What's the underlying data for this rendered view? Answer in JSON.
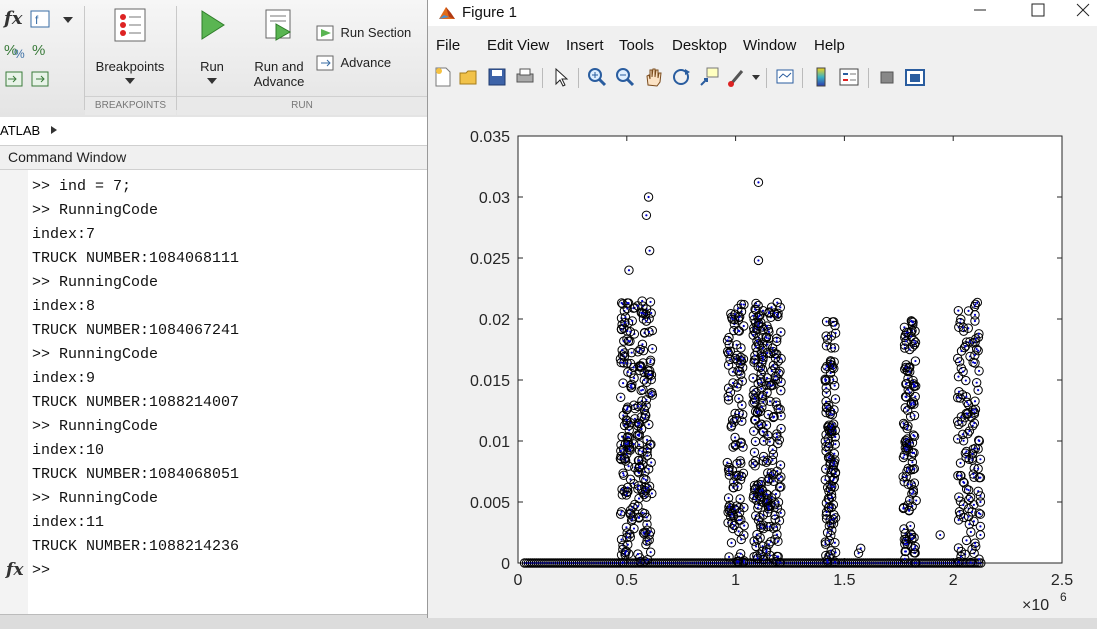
{
  "ribbon": {
    "breakpoints_label": "Breakpoints",
    "run_label": "Run",
    "run_and_advance_label": "Run and\nAdvance",
    "run_and_advance_line1": "Run and",
    "run_and_advance_line2": "Advance",
    "run_section_label": "Run Section",
    "advance_label": "Advance",
    "group_breakpoints": "BREAKPOINTS",
    "group_run": "RUN"
  },
  "address_bar": {
    "path": "ATLAB"
  },
  "command_window": {
    "title": "Command Window",
    "lines": [
      ">> ind = 7;",
      ">> RunningCode",
      "index:7",
      "TRUCK NUMBER:1084068111",
      ">> RunningCode",
      "index:8",
      "TRUCK NUMBER:1084067241",
      ">> RunningCode",
      "index:9",
      "TRUCK NUMBER:1088214007",
      ">> RunningCode",
      "index:10",
      "TRUCK NUMBER:1084068051",
      ">> RunningCode",
      "index:11",
      "TRUCK NUMBER:1088214236"
    ],
    "prompt": ">>",
    "prompt_icon": "fx"
  },
  "figure": {
    "title": "Figure 1",
    "menu": [
      "File",
      "Edit",
      "View",
      "Insert",
      "Tools",
      "Desktop",
      "Window",
      "Help"
    ],
    "toolbar_icons": [
      "new-figure-icon",
      "open-file-icon",
      "save-icon",
      "print-icon",
      "pointer-icon",
      "zoom-in-icon",
      "zoom-out-icon",
      "pan-icon",
      "rotate-3d-icon",
      "data-cursor-icon",
      "brush-icon",
      "link-plot-icon",
      "colorbar-icon",
      "legend-icon",
      "hide-plot-tools-icon",
      "show-plot-tools-icon"
    ],
    "accent_color": "#0000cc"
  },
  "chart_data": {
    "type": "scatter",
    "title": "",
    "xlabel": "",
    "ylabel": "",
    "xlim": [
      0,
      2500000
    ],
    "ylim": [
      0,
      0.035
    ],
    "x_exponent_label": "×10",
    "x_exponent_power": "6",
    "xticks": [
      0,
      500000,
      1000000,
      1500000,
      2000000,
      2500000
    ],
    "xtick_labels": [
      "0",
      "0.5",
      "1",
      "1.5",
      "2",
      "2.5"
    ],
    "yticks": [
      0,
      0.005,
      0.01,
      0.015,
      0.02,
      0.025,
      0.03,
      0.035
    ],
    "ytick_labels": [
      "0",
      "0.005",
      "0.01",
      "0.015",
      "0.02",
      "0.025",
      "0.03",
      "0.035"
    ],
    "grid": false,
    "clusters": [
      {
        "x_range": [
          470000,
          540000
        ],
        "y_max": 0.0215
      },
      {
        "x_range": [
          550000,
          620000
        ],
        "y_max": 0.0215
      },
      {
        "x_range": [
          960000,
          1040000
        ],
        "y_max": 0.0215
      },
      {
        "x_range": [
          1080000,
          1130000
        ],
        "y_max": 0.0215
      },
      {
        "x_range": [
          1140000,
          1210000
        ],
        "y_max": 0.0218
      },
      {
        "x_range": [
          1410000,
          1460000
        ],
        "y_max": 0.02
      },
      {
        "x_range": [
          1770000,
          1830000
        ],
        "y_max": 0.02
      },
      {
        "x_range": [
          2020000,
          2120000
        ],
        "y_max": 0.0215
      }
    ],
    "outliers": [
      {
        "x": 510000,
        "y": 0.024
      },
      {
        "x": 590000,
        "y": 0.0285
      },
      {
        "x": 600000,
        "y": 0.03
      },
      {
        "x": 605000,
        "y": 0.0256
      },
      {
        "x": 1105000,
        "y": 0.0312
      },
      {
        "x": 1105000,
        "y": 0.0248
      },
      {
        "x": 1940000,
        "y": 0.0023
      },
      {
        "x": 2120000,
        "y": 0.01
      },
      {
        "x": 2125000,
        "y": 0.0085
      },
      {
        "x": 2125000,
        "y": 0.007
      },
      {
        "x": 2125000,
        "y": 0.0055
      },
      {
        "x": 2125000,
        "y": 0.005
      },
      {
        "x": 2125000,
        "y": 0.004
      },
      {
        "x": 2125000,
        "y": 0.003
      },
      {
        "x": 2125000,
        "y": 0.0023
      },
      {
        "x": 1565000,
        "y": 0.0008
      },
      {
        "x": 1575000,
        "y": 0.0012
      }
    ],
    "baseline": {
      "x_range": [
        30000,
        2130000
      ],
      "y": 0
    },
    "marker_edge_color": "#000000",
    "marker_center_color": "#0000cc"
  }
}
